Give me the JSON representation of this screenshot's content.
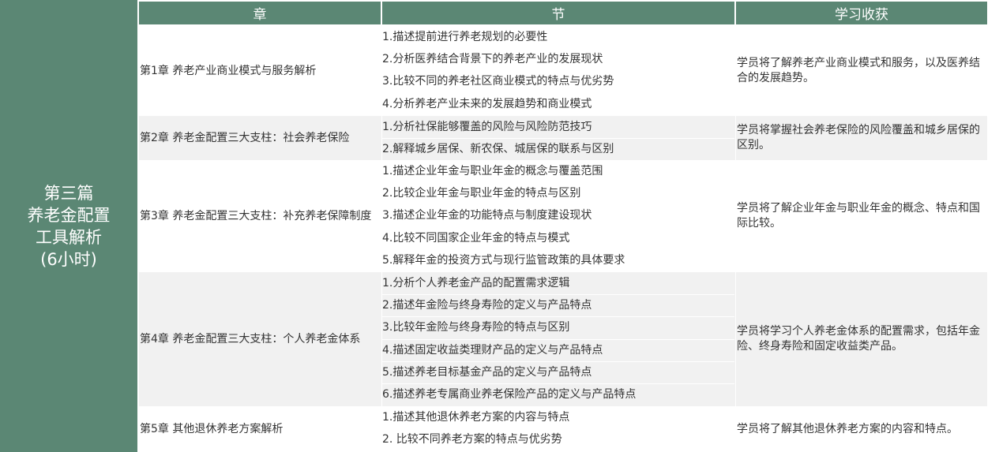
{
  "part": {
    "lines": [
      "第三篇",
      "养老金配置",
      "工具解析",
      "(6小时)"
    ]
  },
  "headers": {
    "chapter": "章",
    "section": "节",
    "gain": "学习收获"
  },
  "chapters": [
    {
      "title": "第1章  养老产业商业模式与服务解析",
      "sections": [
        "1.描述提前进行养老规划的必要性",
        "2.分析医养结合背景下的养老产业的发展现状",
        "3.比较不同的养老社区商业模式的特点与优劣势",
        "4.分析养老产业未来的发展趋势和商业模式"
      ],
      "gain": "学员将了解养老产业商业模式和服务，以及医养结合的发展趋势。"
    },
    {
      "title": "第2章  养老金配置三大支柱：社会养老保险",
      "sections": [
        "1.分析社保能够覆盖的风险与风险防范技巧",
        "2.解释城乡居保、新农保、城居保的联系与区别"
      ],
      "gain": "学员将掌握社会养老保险的风险覆盖和城乡居保的区别。"
    },
    {
      "title": "第3章  养老金配置三大支柱：补充养老保障制度",
      "sections": [
        "1.描述企业年金与职业年金的概念与覆盖范围",
        "2.比较企业年金与职业年金的特点与区别",
        "3.描述企业年金的功能特点与制度建设现状",
        "4.比较不同国家企业年金的特点与模式",
        "5.解释年金的投资方式与现行监管政策的具体要求"
      ],
      "gain": "学员将了解企业年金与职业年金的概念、特点和国际比较。"
    },
    {
      "title": "第4章  养老金配置三大支柱：个人养老金体系",
      "sections": [
        "1.分析个人养老金产品的配置需求逻辑",
        "2.描述年金险与终身寿险的定义与产品特点",
        "3.比较年金险与终身寿险的特点与区别",
        "4.描述固定收益类理财产品的定义与产品特点",
        "5.描述养老目标基金产品的定义与产品特点",
        "6.描述养老专属商业养老保险产品的定义与产品特点"
      ],
      "gain": "学员将学习个人养老金体系的配置需求，包括年金险、终身寿险和固定收益类产品。"
    },
    {
      "title": "第5章  其他退休养老方案解析",
      "sections": [
        "1.描述其他退休养老方案的内容与特点",
        "2. 比较不同养老方案的特点与优劣势"
      ],
      "gain": "学员将了解其他退休养老方案的内容和特点。"
    }
  ]
}
